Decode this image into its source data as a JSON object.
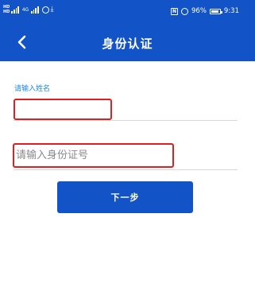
{
  "status_bar": {
    "sim_tags": [
      "HD",
      "HD"
    ],
    "network_label": "4G",
    "battery": "96%",
    "time": "9:31",
    "nfc_letter": "N"
  },
  "app_bar": {
    "back_icon": "chevron-left-icon",
    "title": "身份认证"
  },
  "form": {
    "name_label": "请输入姓名",
    "name_value": "",
    "id_placeholder": "请输入身份证号",
    "id_value": "",
    "next_label": "下一步"
  },
  "colors": {
    "primary": "#1253c7",
    "label_blue": "#1e88e5",
    "highlight_red": "#e02020",
    "background": "#f6f6f8"
  }
}
